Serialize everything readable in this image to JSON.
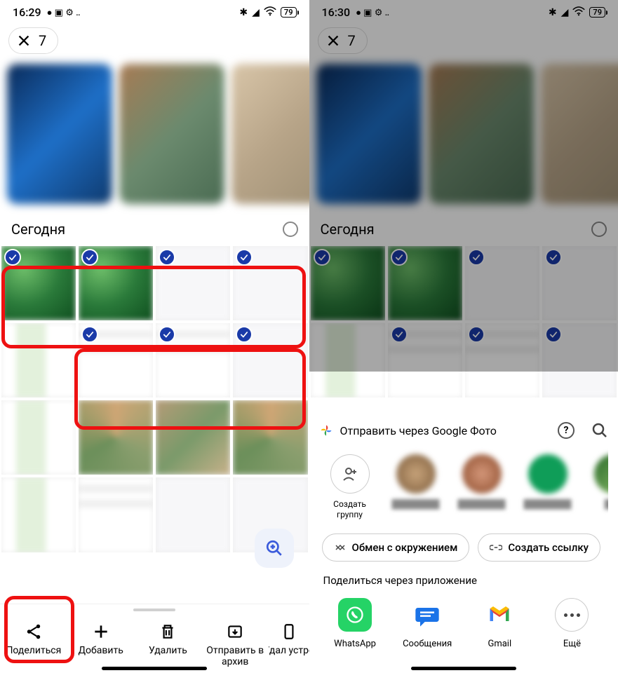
{
  "left": {
    "status_time": "16:29",
    "battery": "79",
    "selection_count": "7",
    "section_title": "Сегодня",
    "actions": {
      "share": "Поделиться",
      "add": "Добавить",
      "delete": "Удалить",
      "archive": "Отправить в архив",
      "device": "Удал устро"
    }
  },
  "right": {
    "status_time": "16:30",
    "battery": "79",
    "selection_count": "7",
    "section_title": "Сегодня",
    "sheet": {
      "title": "Отправить через Google Фото",
      "create_group": "Создать группу",
      "pill_nearby": "Обмен с окружением",
      "pill_link": "Создать ссылку",
      "share_via_app": "Поделиться через приложение",
      "apps": {
        "whatsapp": "WhatsApp",
        "messages": "Сообщения",
        "gmail": "Gmail",
        "more": "Ещё"
      }
    }
  }
}
